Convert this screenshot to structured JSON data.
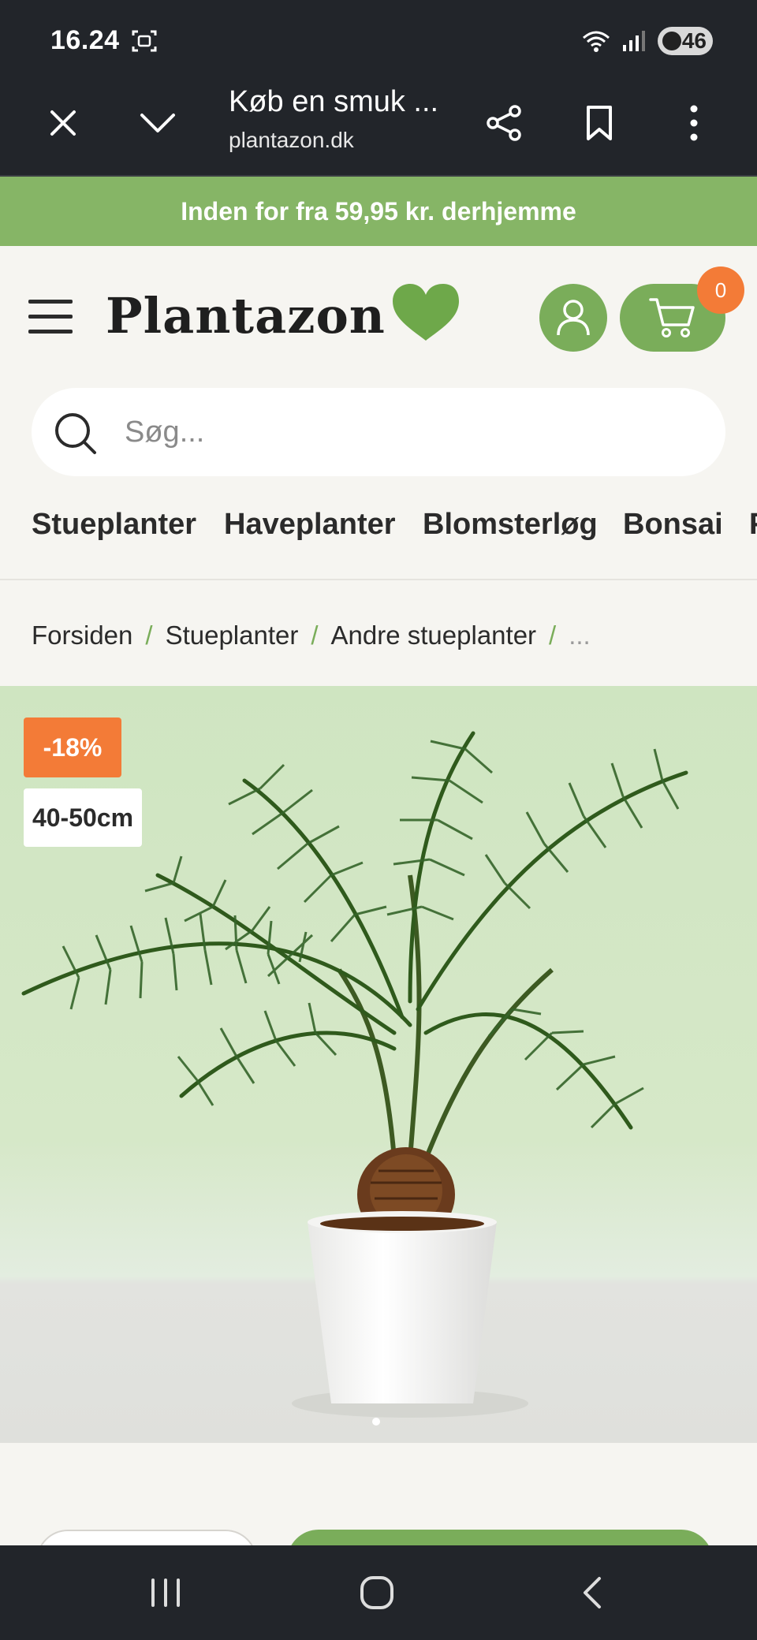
{
  "status_bar": {
    "time": "16.24",
    "battery": "46"
  },
  "browser": {
    "tab_title": "Køb en smuk ...",
    "url": "plantazon.dk"
  },
  "promo": {
    "text": "Inden for fra 59,95 kr. derhjemme"
  },
  "header": {
    "logo": "Plantazon",
    "cart_count": "0"
  },
  "search": {
    "placeholder": "Søg..."
  },
  "categories": [
    "Stueplanter",
    "Haveplanter",
    "Blomsterløg",
    "Bonsai",
    "F"
  ],
  "breadcrumb": {
    "items": [
      "Forsiden",
      "Stueplanter",
      "Andre stueplanter"
    ],
    "separator": "/",
    "more": "..."
  },
  "product": {
    "discount_badge": "-18%",
    "size_badge": "40-50cm"
  },
  "colors": {
    "brand_green": "#7aad5a",
    "promo_green": "#86b566",
    "accent_orange": "#f37b37",
    "dark_bar": "#22252a"
  }
}
